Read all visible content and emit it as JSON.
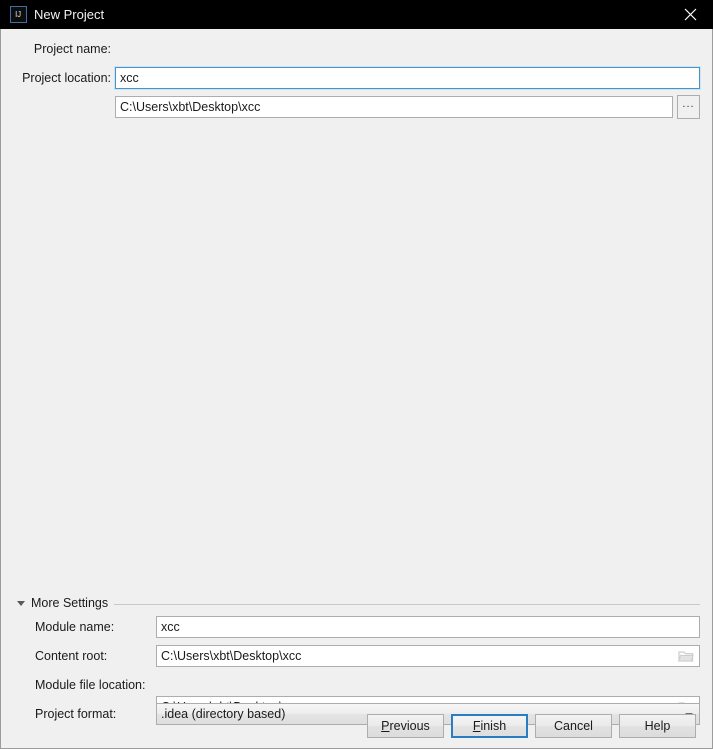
{
  "window": {
    "title": "New Project",
    "app_icon": "intellij-idea-icon",
    "icon_text": "IJ",
    "close_icon": "close-icon",
    "background_color": "#f0f0f0",
    "titlebar_color": "#000000",
    "accent_color": "#2b7dc3"
  },
  "form": {
    "project_name": {
      "label": "Project name:",
      "value": "xcc",
      "focused": true
    },
    "project_location": {
      "label": "Project location:",
      "value": "C:\\Users\\xbt\\Desktop\\xcc",
      "browse_label": "...",
      "browse_icon": "ellipsis-icon"
    }
  },
  "more_settings": {
    "label": "More Settings",
    "expanded": true,
    "toggle_icon": "chevron-down-icon",
    "fields": [
      {
        "name": "module-name",
        "label": "Module name:",
        "value": "xcc",
        "type": "text",
        "icon": null
      },
      {
        "name": "content-root",
        "label": "Content root:",
        "value": "C:\\Users\\xbt\\Desktop\\xcc",
        "type": "text",
        "icon": "folder-icon"
      },
      {
        "name": "module-file-location",
        "label": "Module file location:",
        "value": "C:\\Users\\xbt\\Desktop\\xcc",
        "type": "text",
        "icon": "folder-icon"
      },
      {
        "name": "project-format",
        "label": "Project format:",
        "value": ".idea (directory based)",
        "type": "combo",
        "icon": "chevron-down-icon"
      }
    ]
  },
  "buttons": {
    "previous": {
      "label": "Previous",
      "mnemonic": "P",
      "default": false
    },
    "finish": {
      "label": "Finish",
      "mnemonic": "F",
      "default": true
    },
    "cancel": {
      "label": "Cancel",
      "mnemonic": "",
      "default": false
    },
    "help": {
      "label": "Help",
      "mnemonic": "",
      "default": false
    }
  }
}
